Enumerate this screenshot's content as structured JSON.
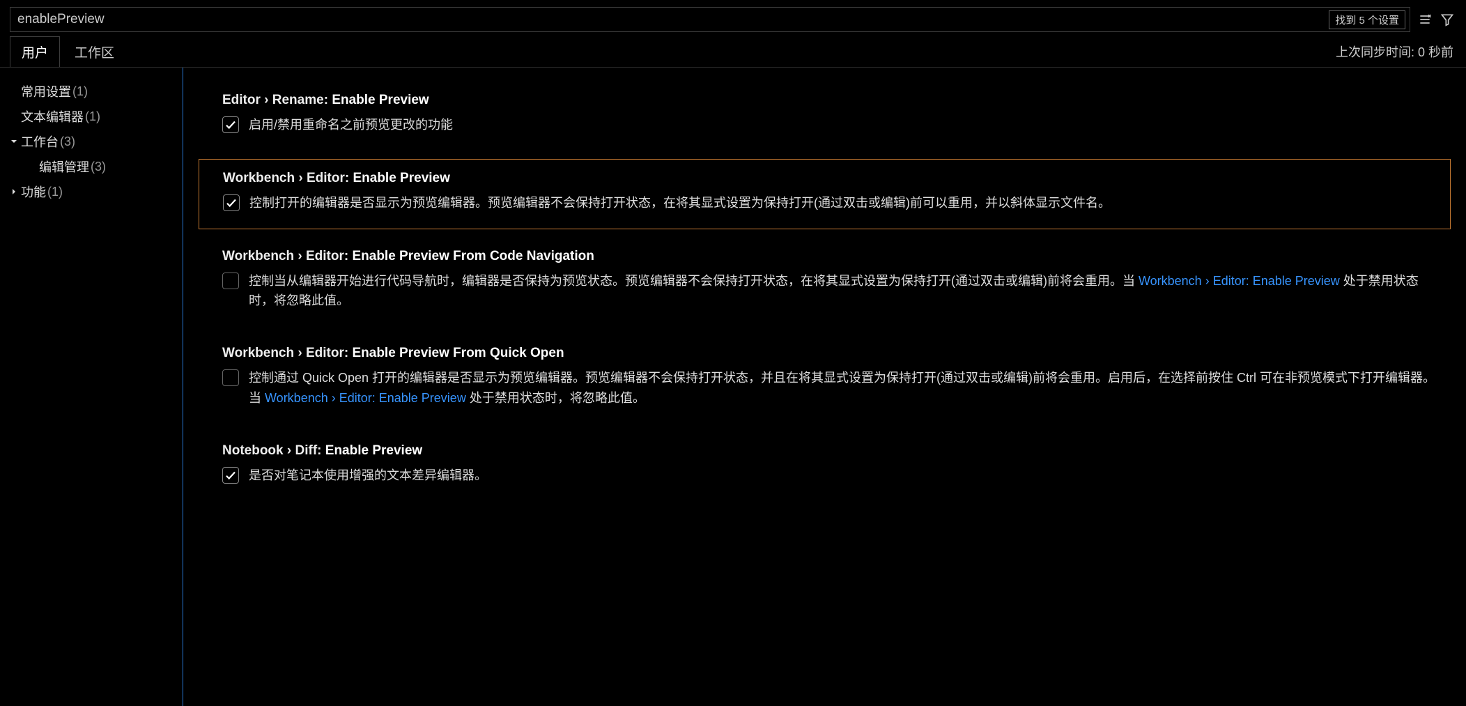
{
  "search": {
    "value": "enablePreview",
    "found_count": "找到 5 个设置"
  },
  "tabs": {
    "user": "用户",
    "workspace": "工作区"
  },
  "sync_status": "上次同步时间: 0 秒前",
  "sidebar": {
    "items": [
      {
        "label": "常用设置",
        "count": "(1)",
        "depth": 0,
        "expandable": false
      },
      {
        "label": "文本编辑器",
        "count": "(1)",
        "depth": 0,
        "expandable": false
      },
      {
        "label": "工作台",
        "count": "(3)",
        "depth": 0,
        "expandable": true,
        "expanded": true
      },
      {
        "label": "编辑管理",
        "count": "(3)",
        "depth": 1,
        "expandable": false
      },
      {
        "label": "功能",
        "count": "(1)",
        "depth": 0,
        "expandable": true,
        "expanded": false
      }
    ]
  },
  "settings": [
    {
      "id": "editor.rename.enablePreview",
      "path": "Editor › Rename: ",
      "leaf": "Enable Preview",
      "checked": true,
      "focused": false,
      "desc_pre": "启用/禁用重命名之前预览更改的功能",
      "link": "",
      "desc_post": ""
    },
    {
      "id": "workbench.editor.enablePreview",
      "path": "Workbench › Editor: ",
      "leaf": "Enable Preview",
      "checked": true,
      "focused": true,
      "desc_pre": "控制打开的编辑器是否显示为预览编辑器。预览编辑器不会保持打开状态，在将其显式设置为保持打开(通过双击或编辑)前可以重用，并以斜体显示文件名。",
      "link": "",
      "desc_post": ""
    },
    {
      "id": "workbench.editor.enablePreviewFromCodeNavigation",
      "path": "Workbench › Editor: ",
      "leaf": "Enable Preview From Code Navigation",
      "checked": false,
      "focused": false,
      "desc_pre": "控制当从编辑器开始进行代码导航时，编辑器是否保持为预览状态。预览编辑器不会保持打开状态，在将其显式设置为保持打开(通过双击或编辑)前将会重用。当 ",
      "link": "Workbench › Editor: Enable Preview",
      "desc_post": " 处于禁用状态时，将忽略此值。"
    },
    {
      "id": "workbench.editor.enablePreviewFromQuickOpen",
      "path": "Workbench › Editor: ",
      "leaf": "Enable Preview From Quick Open",
      "checked": false,
      "focused": false,
      "desc_pre": "控制通过 Quick Open 打开的编辑器是否显示为预览编辑器。预览编辑器不会保持打开状态，并且在将其显式设置为保持打开(通过双击或编辑)前将会重用。启用后，在选择前按住 Ctrl 可在非预览模式下打开编辑器。当 ",
      "link": "Workbench › Editor: Enable Preview",
      "desc_post": " 处于禁用状态时，将忽略此值。"
    },
    {
      "id": "notebook.diff.enablePreview",
      "path": "Notebook › Diff: ",
      "leaf": "Enable Preview",
      "checked": true,
      "focused": false,
      "desc_pre": "是否对笔记本使用增强的文本差异编辑器。",
      "link": "",
      "desc_post": ""
    }
  ]
}
